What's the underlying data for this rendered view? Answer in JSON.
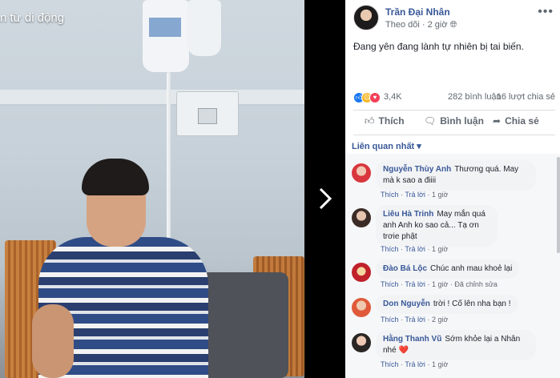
{
  "viewer": {
    "overlay_text": "n từ di động",
    "next_icon": "chevron-right"
  },
  "post": {
    "author": "Trần Đại Nhân",
    "follow_label": "Theo dõi",
    "time": "2 giờ",
    "privacy_icon": "globe",
    "text": "Đang yên đang lành tự nhiên bị tai biến.",
    "reactions": {
      "count": "3,4K",
      "icons": [
        "like",
        "sad",
        "love"
      ],
      "comment_count": "282 bình luận",
      "share_count": "16 lượt chia sẻ"
    },
    "actions": {
      "like": "Thích",
      "comment": "Bình luận",
      "share": "Chia sẻ"
    },
    "sort_label": "Liên quan nhất"
  },
  "comments": [
    {
      "name": "Nguyễn Thùy Anh",
      "text": "Thương quá. May mà k sao a điiii",
      "like": "Thích",
      "reply": "Trả lời",
      "time": "1 giờ",
      "edited": ""
    },
    {
      "name": "Liêu Hà Trinh",
      "text": "May mắn quá anh Anh ko sao cả... Tạ ơn trơie phật",
      "like": "Thích",
      "reply": "Trả lời",
      "time": "1 giờ",
      "edited": ""
    },
    {
      "name": "Đào Bá Lộc",
      "text": "Chúc anh mau khoẻ lại",
      "like": "Thích",
      "reply": "Trả lời",
      "time": "1 giờ",
      "edited": "Đã chỉnh sửa"
    },
    {
      "name": "Don Nguyễn",
      "text": "trời ! Cố lên nha bạn !",
      "like": "Thích",
      "reply": "Trả lời",
      "time": "2 giờ",
      "edited": ""
    },
    {
      "name": "Hằng Thanh Vũ",
      "text": "Sớm khỏe lại a Nhân nhé ❤️",
      "like": "Thích",
      "reply": "Trả lời",
      "time": "1 giờ",
      "edited": ""
    }
  ],
  "colors": {
    "link": "#385898",
    "like_reaction": "#1877f2",
    "sad_reaction": "#f7b928",
    "love_reaction": "#f33e58"
  }
}
